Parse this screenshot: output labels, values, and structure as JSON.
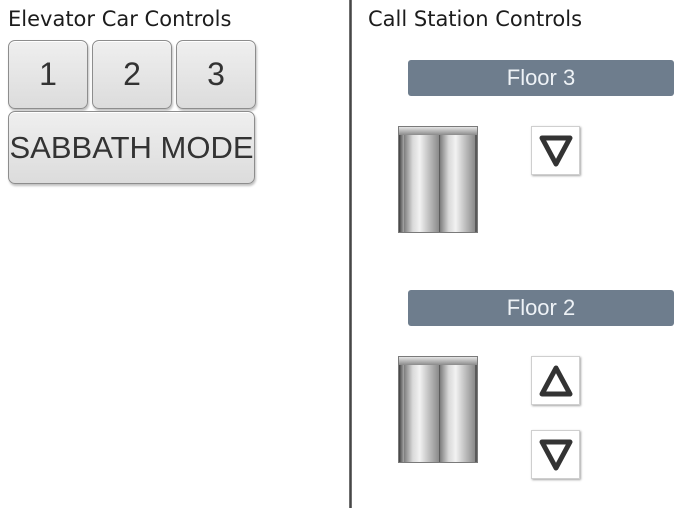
{
  "car_controls": {
    "title": "Elevator Car Controls",
    "floor_buttons": [
      {
        "label": "1"
      },
      {
        "label": "2"
      },
      {
        "label": "3"
      }
    ],
    "sabbath_label": "SABBATH MODE"
  },
  "call_station": {
    "title": "Call Station Controls",
    "floors": [
      {
        "header": "Floor 3",
        "buttons": [
          "down-arrow-icon"
        ]
      },
      {
        "header": "Floor 2",
        "buttons": [
          "up-arrow-icon",
          "down-arrow-icon"
        ]
      }
    ]
  },
  "colors": {
    "floor_header_bg": "#6e7d8d",
    "floor_header_text": "#eef2f6",
    "button_face": "#e4e4e4",
    "arrow_icon": "#333333"
  }
}
